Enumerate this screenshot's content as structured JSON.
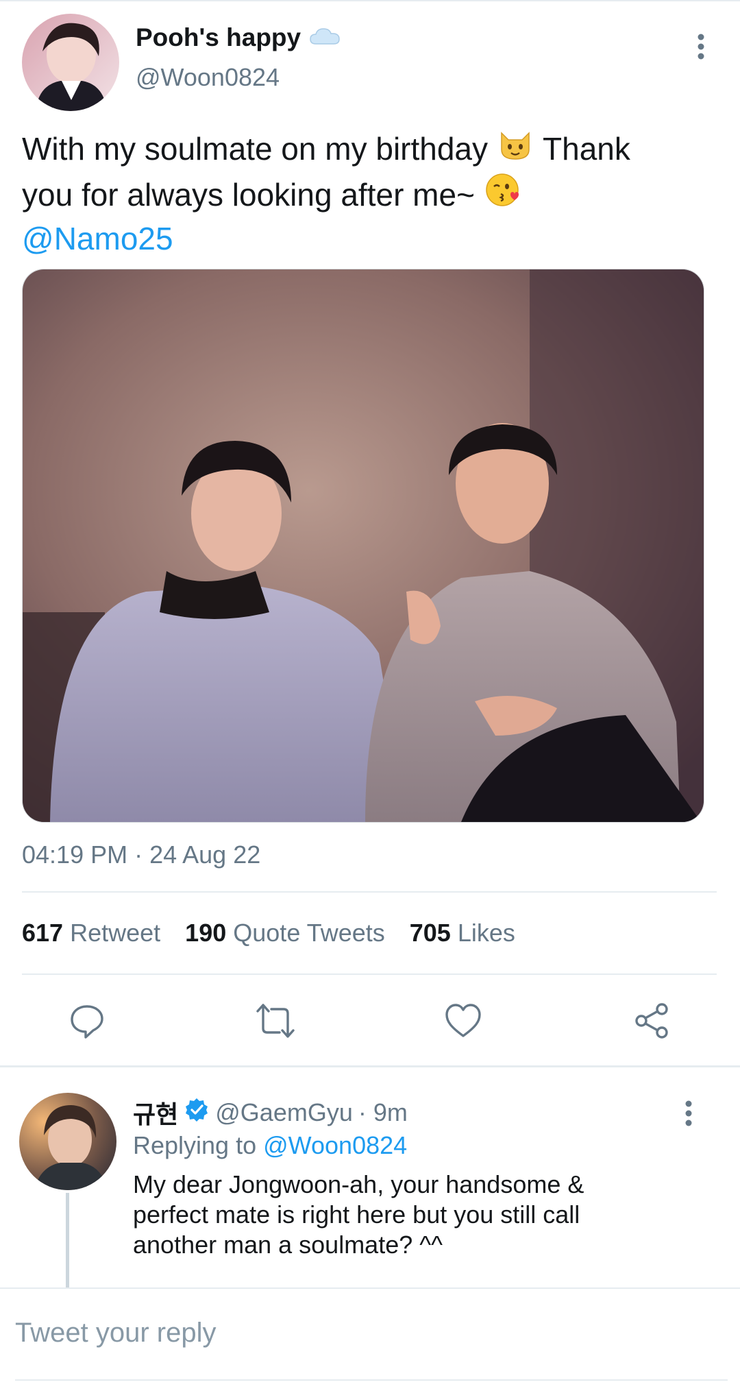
{
  "colors": {
    "accent": "#1d9bf0",
    "text": "#14171a",
    "muted": "#657786",
    "divider": "#e6ecf0",
    "verified": "#1d9bf0"
  },
  "tweet": {
    "author": {
      "display_name": "Pooh's happy",
      "name_emoji_icon": "cloud-icon",
      "handle": "@Woon0824"
    },
    "text_line_1_a": "With my soulmate on my birthday",
    "text_emoji_1_icon": "cat-face-icon",
    "text_line_1_b": "Thank",
    "text_line_2": "you for always looking after me~",
    "text_emoji_2_icon": "face-blowing-kiss-icon",
    "mention": "@Namo25",
    "photo_icon": "photo-two-people-icon",
    "timestamp": "04:19 PM · 24 Aug 22",
    "stats": {
      "retweets_count": "617",
      "retweets_label": "Retweet",
      "quotes_count": "190",
      "quotes_label": "Quote Tweets",
      "likes_count": "705",
      "likes_label": "Likes"
    },
    "actions": [
      "reply-icon",
      "retweet-icon",
      "like-icon",
      "share-icon"
    ]
  },
  "reply": {
    "author": {
      "display_name": "규현",
      "verified_icon": "verified-badge-icon",
      "handle": "@GaemGyu",
      "time": "· 9m"
    },
    "replying_to_label": "Replying to",
    "replying_to_handle": "@Woon0824",
    "text_line_1": "My dear Jongwoon-ah, your handsome &",
    "text_line_2": "perfect mate is right here but you still call",
    "text_line_3": "another man a soulmate? ^^"
  },
  "composer": {
    "placeholder": "Tweet your reply"
  }
}
